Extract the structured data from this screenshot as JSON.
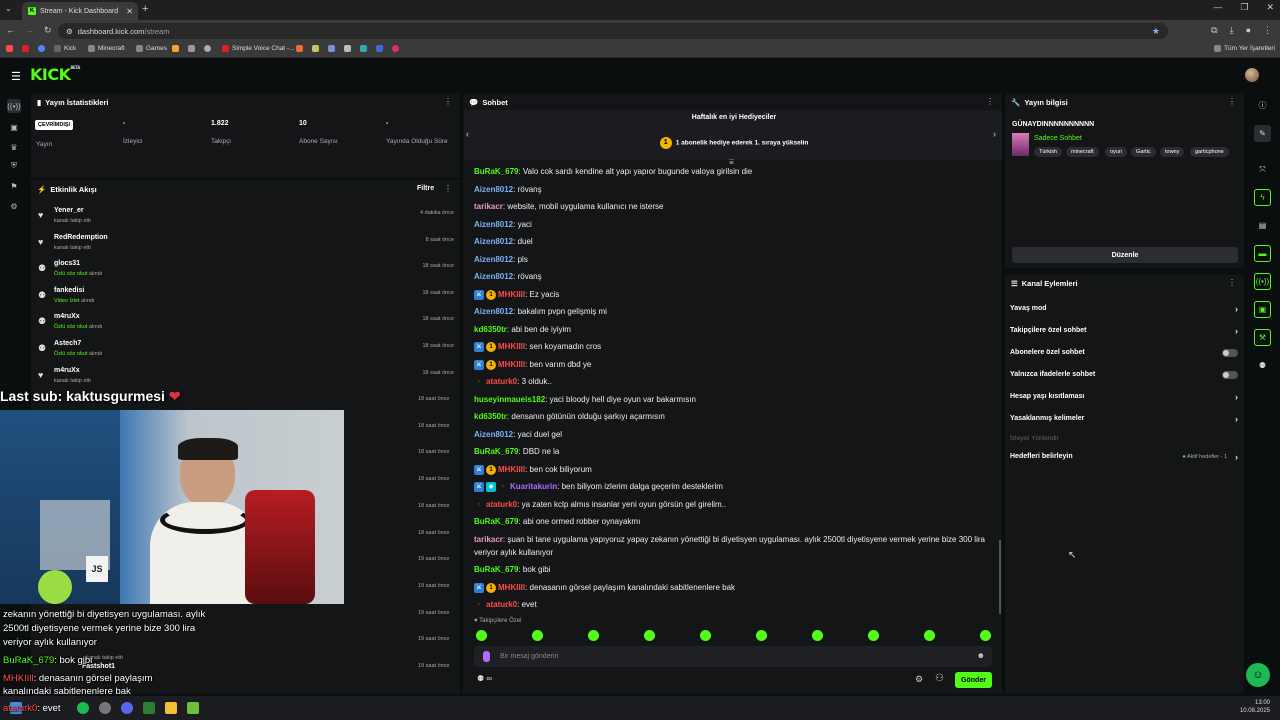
{
  "browser": {
    "tab_title": "Stream - Kick Dashboard",
    "url_host": "dashboard.kick.com",
    "url_path": "/stream",
    "bookmarks": [
      "Kick",
      "Minecraft",
      "Games",
      "Simple Voice Chat -..."
    ],
    "bookmarks_right": "Tüm Yer İşaretleri"
  },
  "app": {
    "logo": "KICK",
    "logo_badge": "BETA"
  },
  "stats": {
    "title": "Yayın İstatistikleri",
    "status_badge": "ÇEVRİMDIŞI",
    "items": [
      {
        "value": "",
        "label": "Yayın"
      },
      {
        "value": "-",
        "label": "İzleyici"
      },
      {
        "value": "1.822",
        "label": "Takipçi"
      },
      {
        "value": "10",
        "label": "Abone Sayısı"
      },
      {
        "value": "-",
        "label": "Yayında Olduğu Süre"
      }
    ]
  },
  "feed": {
    "title": "Etkinlik Akışı",
    "filter": "Filtre",
    "rows": [
      {
        "name": "Yener_er",
        "pre": "",
        "green": "",
        "post": "kanalı takip etti",
        "time": "4 dakika önce",
        "icon": "heart"
      },
      {
        "name": "RedRedemption",
        "pre": "",
        "green": "",
        "post": "kanalı takip etti",
        "time": "8 saat önce",
        "icon": "heart"
      },
      {
        "name": "glocs31",
        "pre": "",
        "green": "Özlü söz okut",
        "post": " alındı",
        "time": "18 saat önce",
        "icon": "reward"
      },
      {
        "name": "fankedisi",
        "pre": "",
        "green": "Video İzlet",
        "post": " alındı",
        "time": "18 saat önce",
        "icon": "reward"
      },
      {
        "name": "m4ruXx",
        "pre": "",
        "green": "Özlü söz okut",
        "post": " alındı",
        "time": "18 saat önce",
        "icon": "reward"
      },
      {
        "name": "Astech7",
        "pre": "",
        "green": "Özlü söz okut",
        "post": " alındı",
        "time": "18 saat önce",
        "icon": "reward"
      },
      {
        "name": "m4ruXx",
        "pre": "",
        "green": "",
        "post": "kanalı takip etti",
        "time": "18 saat önce",
        "icon": "heart"
      }
    ],
    "hidden_times": [
      "18 saat önce",
      "18 saat önce",
      "18 saat önce",
      "18 saat önce",
      "18 saat önce",
      "18 saat önce",
      "19 saat önce",
      "19 saat önce",
      "19 saat önce",
      "19 saat önce",
      "19 saat önce"
    ],
    "partial_rows": [
      {
        "name": "Fastshot1",
        "sub": "kanalı takip etti"
      }
    ]
  },
  "overlay": {
    "last_sub": "Last sub: kaktusgurmesi",
    "caption_lines": [
      "zekanın yönettiği bi diyetisyen uygulaması. aylık",
      "2500tl diyetisyene vermek yerine bize 300 lira",
      "veriyor aylık kullanıyor"
    ],
    "caption_user1": "BuRaK_679",
    "caption_msg1": ": bok gibi",
    "caption_user2": "MHKIIll",
    "caption_msg2": ": denasanın görsel paylaşım",
    "caption_msg2b": "kanalındaki sabitlenenlere bak",
    "caption_user3": "ataturk0",
    "caption_msg3": ": evet",
    "cam_label": "JS"
  },
  "chat": {
    "title": "Sohbet",
    "banner_title": "Haftalık en iyi Hediyeciler",
    "banner_rank": "1",
    "banner_text": "1 abonelik hediye ederek 1. sıraya yükselin",
    "messages": [
      {
        "user": "BuRaK_679",
        "color": "#53fc18",
        "text": ": Valo cok sardı kendine alt yapı yapıor bugunde valoya girilsin die",
        "badges": []
      },
      {
        "user": "Aizen8012",
        "color": "#7cb4f5",
        "text": ": rövanş",
        "badges": []
      },
      {
        "user": "tarikacr",
        "color": "#e79ac0",
        "text": ": website, mobil uygulama kullanıcı ne isterse",
        "badges": []
      },
      {
        "user": "Aizen8012",
        "color": "#7cb4f5",
        "text": ": yaci",
        "badges": []
      },
      {
        "user": "Aizen8012",
        "color": "#7cb4f5",
        "text": ": duel",
        "badges": []
      },
      {
        "user": "Aizen8012",
        "color": "#7cb4f5",
        "text": ": pls",
        "badges": []
      },
      {
        "user": "Aizen8012",
        "color": "#7cb4f5",
        "text": ": rövanş",
        "badges": []
      },
      {
        "user": "MHKIIll",
        "color": "#ff4a4a",
        "text": ": Ez yacis",
        "badges": [
          "mod",
          "sub"
        ]
      },
      {
        "user": "Aizen8012",
        "color": "#7cb4f5",
        "text": ": bakalım pvpn gelişmiş mi",
        "badges": []
      },
      {
        "user": "kd6350tr",
        "color": "#53fc18",
        "text": ": abi ben de iyiyim",
        "badges": []
      },
      {
        "user": "MHKIIll",
        "color": "#ff4a4a",
        "text": ": sen koyamadın cros",
        "badges": [
          "mod",
          "sub"
        ]
      },
      {
        "user": "MHKIIll",
        "color": "#ff4a4a",
        "text": ": ben varım dbd ye",
        "badges": [
          "mod",
          "sub"
        ]
      },
      {
        "user": "ataturk0",
        "color": "#ff4a4a",
        "text": ": 3 olduk..",
        "badges": [
          "og"
        ]
      },
      {
        "user": "huseyinmaueis182",
        "color": "#53fc18",
        "text": ": yaci bloody hell diye oyun var bakarmısın",
        "badges": []
      },
      {
        "user": "kd6350tr",
        "color": "#53fc18",
        "text": ": densanın götünün olduğu şarkıyı açarmısın",
        "badges": []
      },
      {
        "user": "Aizen8012",
        "color": "#7cb4f5",
        "text": ": yaci duel gel",
        "badges": []
      },
      {
        "user": "BuRaK_679",
        "color": "#53fc18",
        "text": ": DBD ne la",
        "badges": []
      },
      {
        "user": "MHKIIll",
        "color": "#ff4a4a",
        "text": ": ben cok biliyorum",
        "badges": [
          "mod",
          "sub"
        ]
      },
      {
        "user": "Kuaritakurin",
        "color": "#b06cff",
        "text": ": ben biliyom izlerim dalga geçerim desteklerim",
        "badges": [
          "mod",
          "vip",
          "og"
        ]
      },
      {
        "user": "ataturk0",
        "color": "#ff4a4a",
        "text": ": ya zaten kclp almıs insanlar yeni oyun görsün gel girelim..",
        "badges": [
          "og"
        ]
      },
      {
        "user": "BuRaK_679",
        "color": "#53fc18",
        "text": ": abi one ormed robber oynayakmı",
        "badges": []
      }
    ],
    "long_msg_user": "tarikacr",
    "long_msg_text": ": şuan bi tane uygulama yapıyoruz yapay zekanın yönettiği bi diyetisyen uygulaması. aylık 2500tl diyetisyene vermek yerine bize 300 lira veriyor aylık kullanıyor",
    "tail": [
      {
        "user": "BuRaK_679",
        "color": "#53fc18",
        "text": ": bok gibi",
        "badges": []
      },
      {
        "user": "MHKIIll",
        "color": "#ff4a4a",
        "text": ": denasanın görsel paylaşım kanalındaki sabitlenenlere bak",
        "badges": [
          "mod",
          "sub"
        ]
      },
      {
        "user": "ataturk0",
        "color": "#ff4a4a",
        "text": ": evet",
        "badges": [
          "og"
        ]
      }
    ],
    "followers_only": "Takipçilere Özel",
    "input_placeholder": "Bir mesaj gönderin",
    "send_label": "Gönder",
    "points": "∞"
  },
  "stream_info": {
    "title": "Yayın bilgisi",
    "stream_title": "GÜNAYDINNNNNNNNNN",
    "category": "Sadece Sohbet",
    "tags": [
      "Türkish",
      "minecraft",
      "oyun",
      "Gartic",
      "towny",
      "garticphone"
    ],
    "edit_label": "Düzenle"
  },
  "channel_actions": {
    "title": "Kanal Eylemleri",
    "items": [
      {
        "label": "Yavaş mod",
        "kind": "chevron"
      },
      {
        "label": "Takipçilere özel sohbet",
        "kind": "chevron"
      },
      {
        "label": "Abonelere özel sohbet",
        "kind": "toggle"
      },
      {
        "label": "Yalnızca ifadelerle sohbet",
        "kind": "toggle"
      },
      {
        "label": "Hesap yaşı kısıtlaması",
        "kind": "chevron"
      },
      {
        "label": "Yasaklanmış kelimeler",
        "kind": "chevron"
      }
    ],
    "disabled_item": "İzleyici Yönlendir",
    "goals_label": "Hedefleri belirleyin",
    "goals_status": "Aktif hedefler - 1"
  },
  "taskbar": {
    "time": "13:00",
    "date": "10.08.2025"
  }
}
